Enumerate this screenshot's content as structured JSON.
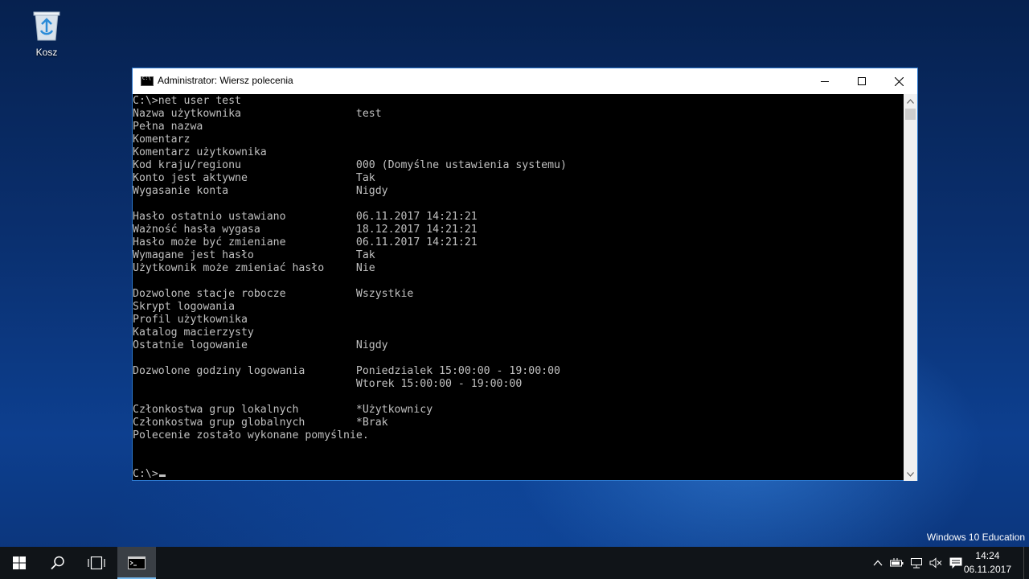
{
  "desktop": {
    "recycle_bin_label": "Kosz",
    "edition_text": "Windows 10 Education"
  },
  "window": {
    "title": "Administrator: Wiersz polecenia",
    "console_lines": [
      "C:\\>net user test",
      "Nazwa użytkownika                  test",
      "Pełna nazwa",
      "Komentarz",
      "Komentarz użytkownika",
      "Kod kraju/regionu                  000 (Domyślne ustawienia systemu)",
      "Konto jest aktywne                 Tak",
      "Wygasanie konta                    Nigdy",
      "",
      "Hasło ostatnio ustawiano           06.11.2017 14:21:21",
      "Ważność hasła wygasa               18.12.2017 14:21:21",
      "Hasło może być zmieniane           06.11.2017 14:21:21",
      "Wymagane jest hasło                Tak",
      "Użytkownik może zmieniać hasło     Nie",
      "",
      "Dozwolone stacje robocze           Wszystkie",
      "Skrypt logowania",
      "Profil użytkownika",
      "Katalog macierzysty",
      "Ostatnie logowanie                 Nigdy",
      "",
      "Dozwolone godziny logowania        Poniedzialek 15:00:00 - 19:00:00",
      "                                   Wtorek 15:00:00 - 19:00:00",
      "",
      "Członkostwa grup lokalnych         *Użytkownicy",
      "Członkostwa grup globalnych        *Brak",
      "Polecenie zostało wykonane pomyślnie.",
      "",
      "",
      "C:\\>"
    ]
  },
  "taskbar": {
    "clock_time": "14:24",
    "clock_date": "06.11.2017",
    "icons": [
      "windows-start-icon",
      "search-icon",
      "task-view-icon",
      "cmd-icon"
    ],
    "tray_icons": [
      "chevron-up-icon",
      "battery-icon",
      "network-icon",
      "volume-muted-icon",
      "action-center-icon"
    ]
  }
}
